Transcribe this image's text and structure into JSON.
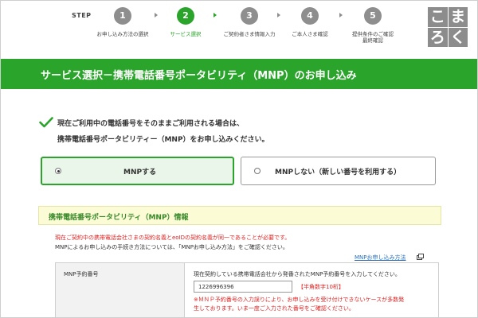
{
  "stepbar": {
    "label": "STEP",
    "steps": [
      {
        "num": "1",
        "caption": "お申し込み方法の選択",
        "caption2": ""
      },
      {
        "num": "2",
        "caption": "サービス選択",
        "caption2": ""
      },
      {
        "num": "3",
        "caption": "ご契約者さま情報入力",
        "caption2": ""
      },
      {
        "num": "4",
        "caption": "ご本人さま確認",
        "caption2": ""
      },
      {
        "num": "5",
        "caption": "提供条件のご確認",
        "caption2": "最終確認"
      }
    ],
    "active_step": 2
  },
  "logo": {
    "chars": [
      "こ",
      "ま",
      "ろ",
      "く"
    ]
  },
  "banner": {
    "title": "サービス選択－携帯電話番号ポータビリティ（MNP）のお申し込み"
  },
  "info": {
    "line1": "現在ご利用中の電話番号をそのままご利用される場合は、",
    "line2": "携帯電話番号ポータビリティー（MNP）をお申し込みください。"
  },
  "options": {
    "mnp_label": "MNPする",
    "no_mnp_label": "MNPしない（新しい番号を利用する）",
    "selected": "mnp"
  },
  "section": {
    "title": "携帯電話番号ポータビリティ（MNP）情報"
  },
  "notes": {
    "warning": "現在ご契約中の携帯電話会社さまの契約名義とeoIDの契約名義が同一であることが必要です。",
    "howto": "MNPによるお申し込みの手続き方法については、「MNPお申し込み方法」をご確認ください。",
    "link": "MNPお申し込み方法"
  },
  "form": {
    "field_label": "MNP予約番号",
    "description": "現在契約している携帯電話会社から発番されたMNP予約番号を入力してください。",
    "value": "1226996396",
    "hint": "【半角数字10桁】",
    "error_line1": "※ＭＮＰ予約番号の入力誤りにより、お申し込みを受け付けできないケースが多数発",
    "error_line2": "生しております。いま一度ご入力された番号をご確認ください。"
  },
  "colors": {
    "brand_green": "#2aa42a",
    "inactive_step": "#8e8e8e",
    "error_red": "#dd2222",
    "link_blue": "#2a6fb5",
    "section_bg": "#fbfbd6"
  }
}
